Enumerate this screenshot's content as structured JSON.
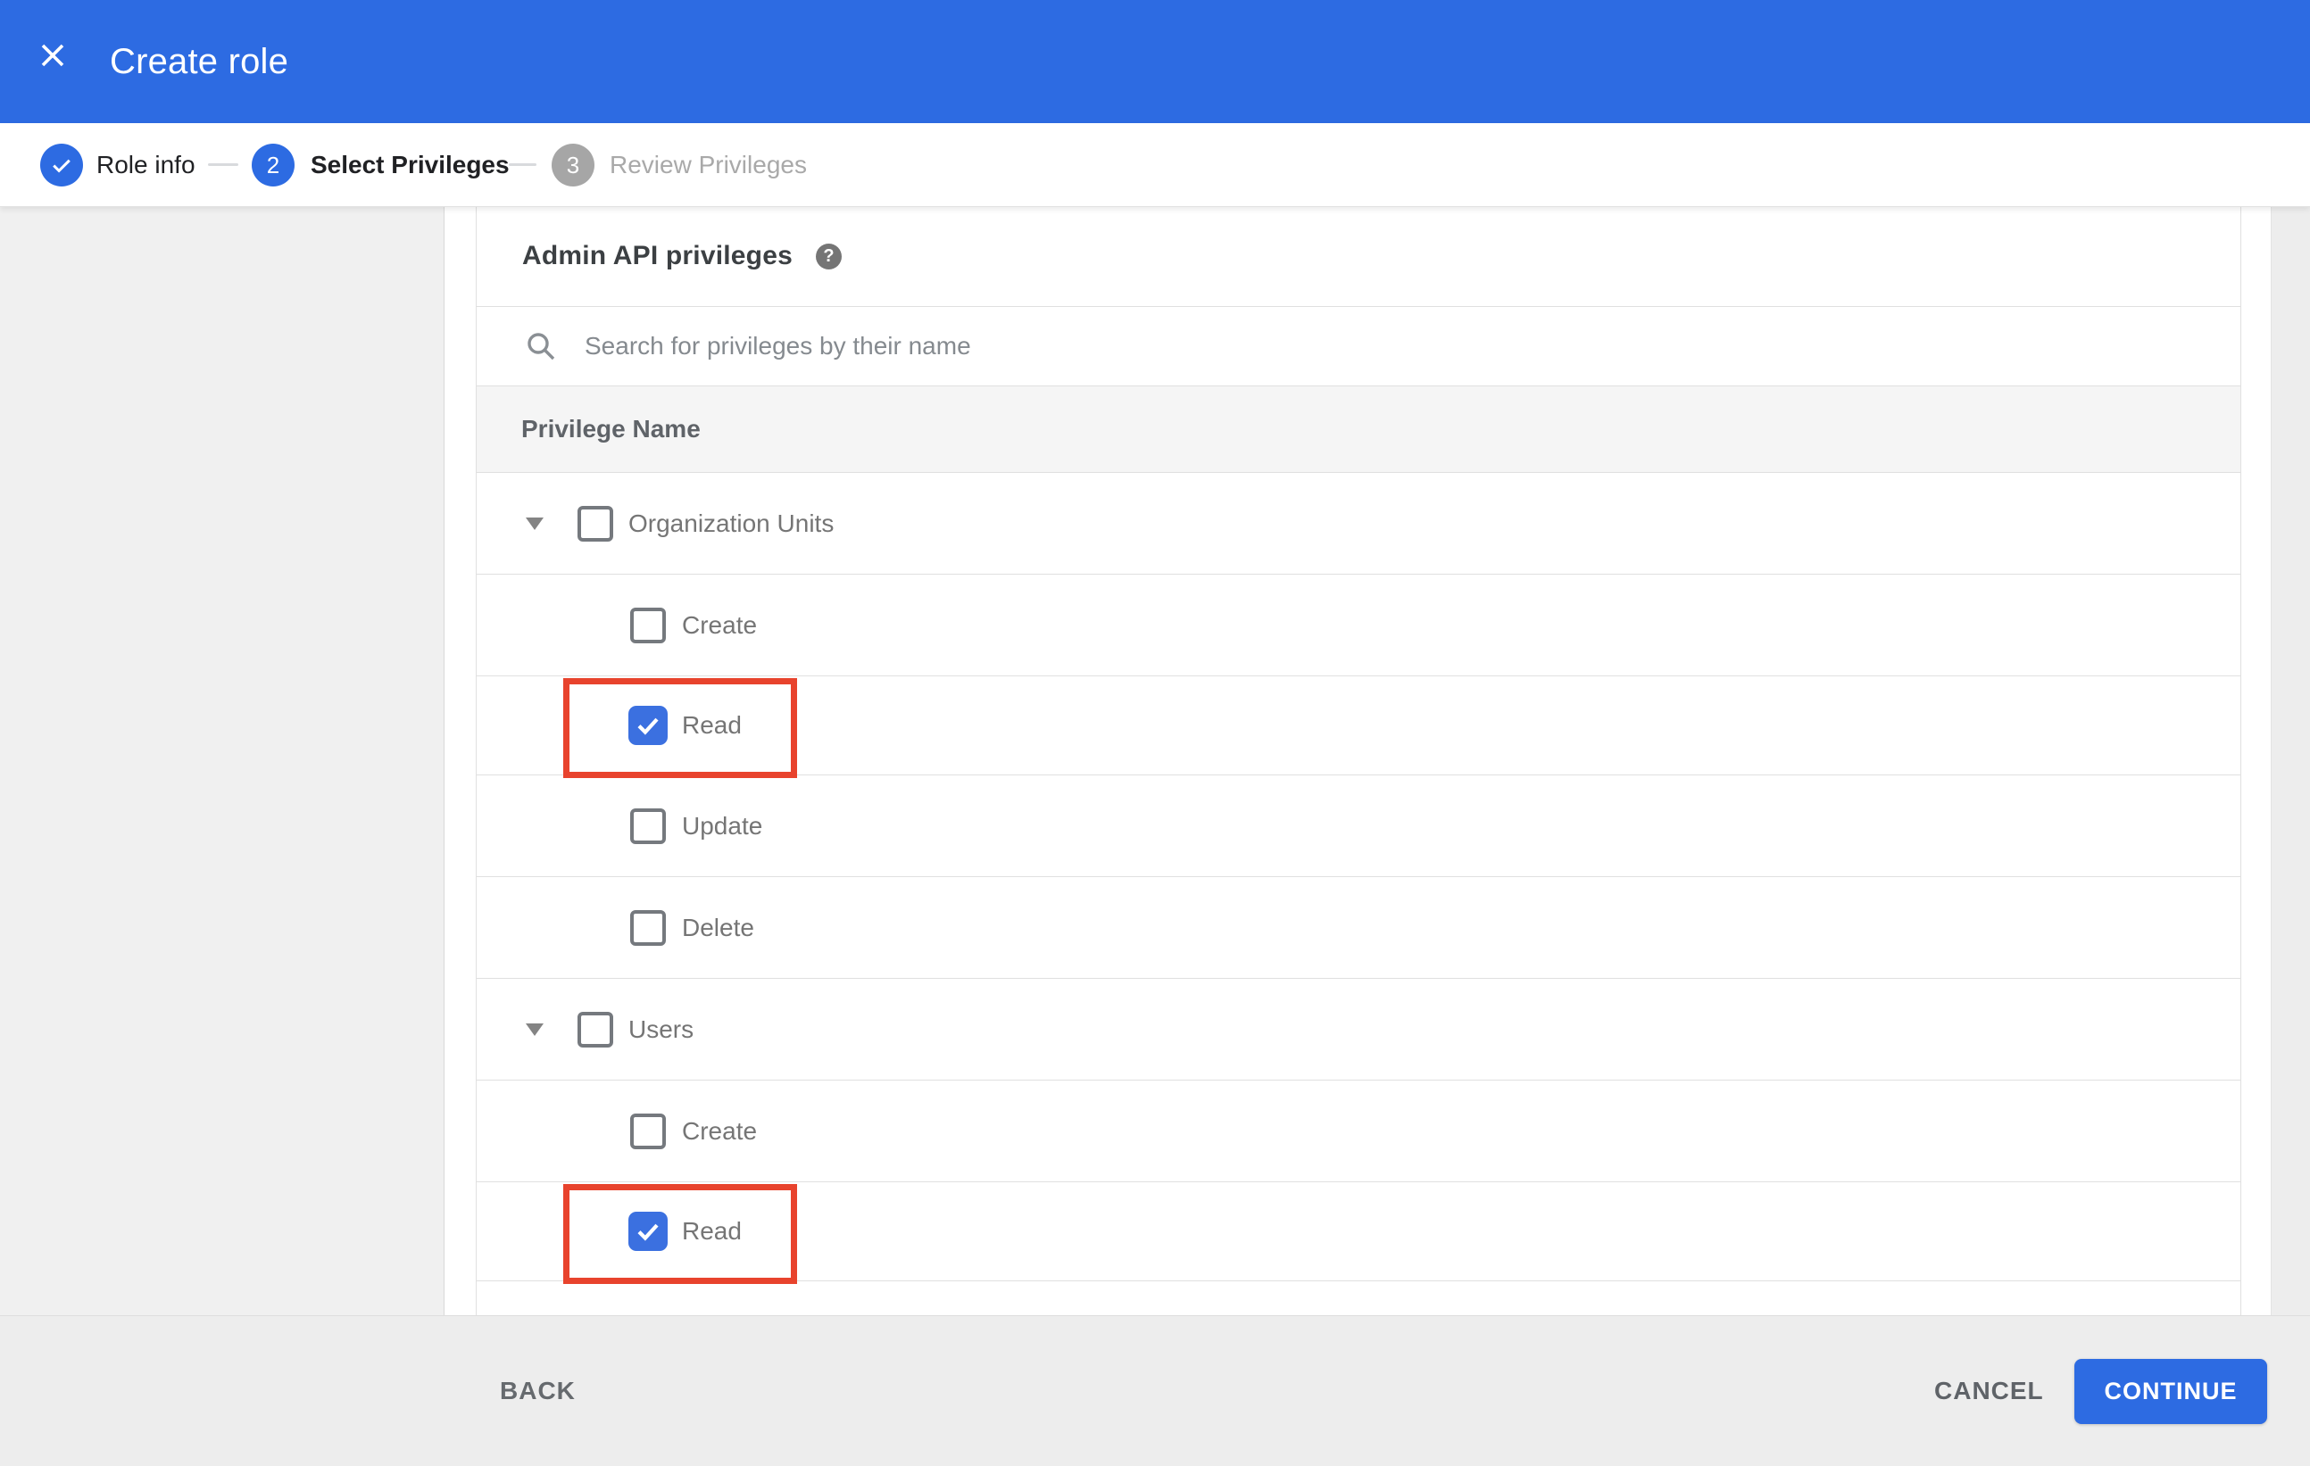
{
  "appbar": {
    "title": "Create role",
    "close_icon": "x-icon",
    "color": "#2d6be2"
  },
  "stepper": {
    "steps": [
      {
        "label": "Role info",
        "state": "complete",
        "icon": "check-icon"
      },
      {
        "label": "Select Privileges",
        "state": "active",
        "number": "2"
      },
      {
        "label": "Review Privileges",
        "state": "upcoming",
        "number": "3"
      }
    ]
  },
  "content": {
    "section_title": "Admin API privileges",
    "help_icon": "question-mark-icon",
    "search": {
      "icon": "magnifier-icon",
      "placeholder": "Search for privileges by their name",
      "value": ""
    },
    "table": {
      "header": "Privilege Name",
      "rows": [
        {
          "label": "Organization Units",
          "level": 1,
          "caret": true,
          "checked": false,
          "highlighted": false
        },
        {
          "label": "Create",
          "level": 2,
          "caret": false,
          "checked": false,
          "highlighted": false
        },
        {
          "label": "Read",
          "level": 2,
          "caret": false,
          "checked": true,
          "highlighted": true
        },
        {
          "label": "Update",
          "level": 2,
          "caret": false,
          "checked": false,
          "highlighted": false
        },
        {
          "label": "Delete",
          "level": 2,
          "caret": false,
          "checked": false,
          "highlighted": false
        },
        {
          "label": "Users",
          "level": 1,
          "caret": true,
          "checked": false,
          "highlighted": false
        },
        {
          "label": "Create",
          "level": 2,
          "caret": false,
          "checked": false,
          "highlighted": false
        },
        {
          "label": "Read",
          "level": 2,
          "caret": false,
          "checked": true,
          "highlighted": true
        }
      ]
    }
  },
  "footer": {
    "back_label": "BACK",
    "cancel_label": "CANCEL",
    "continue_label": "CONTINUE"
  },
  "colors": {
    "accent_blue": "#2d6be2",
    "checkbox_blue": "#3b70e0",
    "highlight_red": "#e8432d",
    "side_panel_gray": "#f0f0f0",
    "footer_gray": "#ededed",
    "table_header_gray": "#f5f5f5",
    "row_border": "#e0e0e0",
    "label_gray": "#757575"
  }
}
